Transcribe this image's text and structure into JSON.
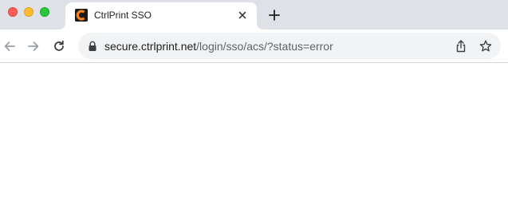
{
  "window": {
    "controls": [
      "close",
      "minimize",
      "maximize"
    ],
    "colors": {
      "close": "#ff5f57",
      "minimize": "#febc2e",
      "maximize": "#28c840"
    }
  },
  "tab": {
    "title": "CtrlPrint SSO",
    "favicon": "ctrlprint-logo-icon",
    "favicon_color": "#f58220",
    "close_icon": "close-icon"
  },
  "new_tab_icon": "plus-icon",
  "toolbar": {
    "back_icon": "arrow-left-icon",
    "forward_icon": "arrow-right-icon",
    "reload_icon": "reload-icon"
  },
  "address_bar": {
    "lock_icon": "lock-icon",
    "host": "secure.ctrlprint.net",
    "path": "/login/sso/acs/?status=error",
    "share_icon": "share-icon",
    "bookmark_icon": "star-icon"
  }
}
